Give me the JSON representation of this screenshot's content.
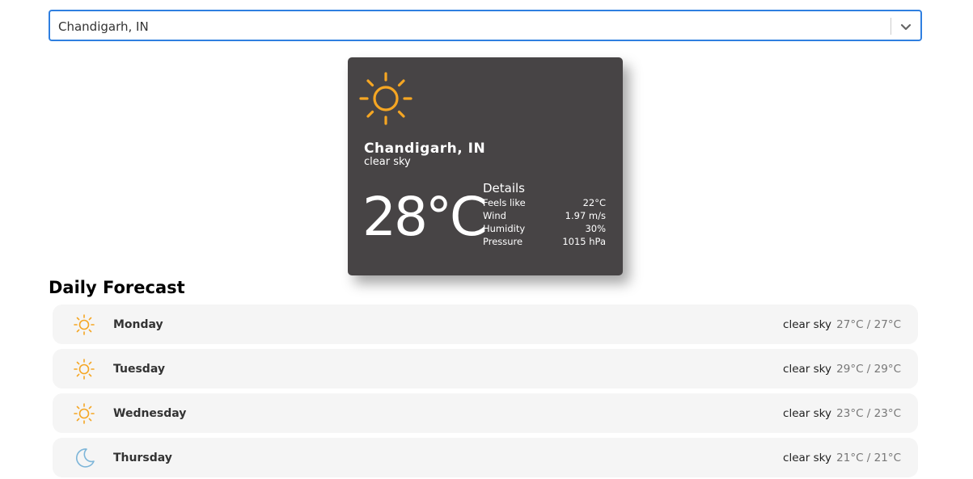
{
  "search": {
    "value": "Chandigarh, IN"
  },
  "current": {
    "icon": "sun-icon",
    "city": "Chandigarh, IN",
    "description": "clear sky",
    "temperature": "28°C",
    "details_title": "Details",
    "details": [
      {
        "label": "Feels like",
        "value": "22°C"
      },
      {
        "label": "Wind",
        "value": "1.97 m/s"
      },
      {
        "label": "Humidity",
        "value": "30%"
      },
      {
        "label": "Pressure",
        "value": "1015 hPa"
      }
    ]
  },
  "forecast": {
    "title": "Daily Forecast",
    "days": [
      {
        "icon": "sun-icon",
        "day": "Monday",
        "description": "clear sky",
        "temps": "27°C / 27°C"
      },
      {
        "icon": "sun-icon",
        "day": "Tuesday",
        "description": "clear sky",
        "temps": "29°C / 29°C"
      },
      {
        "icon": "sun-icon",
        "day": "Wednesday",
        "description": "clear sky",
        "temps": "23°C / 23°C"
      },
      {
        "icon": "moon-icon",
        "day": "Thursday",
        "description": "clear sky",
        "temps": "21°C / 21°C"
      }
    ]
  },
  "colors": {
    "accent": "#2f7fe0",
    "card_bg": "#474445",
    "sun": "#f5a623",
    "moon": "#7eb6d9",
    "row_bg": "#f5f5f5"
  }
}
